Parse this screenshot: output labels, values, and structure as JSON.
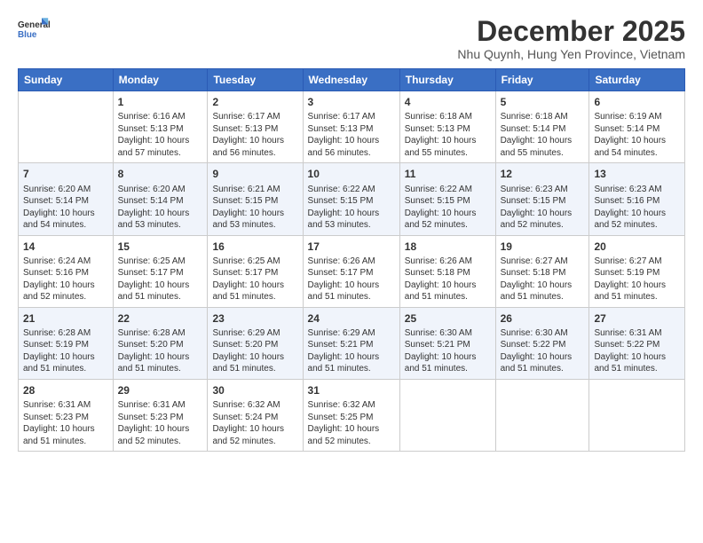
{
  "header": {
    "logo_line1": "General",
    "logo_line2": "Blue",
    "month": "December 2025",
    "location": "Nhu Quynh, Hung Yen Province, Vietnam"
  },
  "weekdays": [
    "Sunday",
    "Monday",
    "Tuesday",
    "Wednesday",
    "Thursday",
    "Friday",
    "Saturday"
  ],
  "weeks": [
    [
      {
        "day": "",
        "text": ""
      },
      {
        "day": "1",
        "text": "Sunrise: 6:16 AM\nSunset: 5:13 PM\nDaylight: 10 hours\nand 57 minutes."
      },
      {
        "day": "2",
        "text": "Sunrise: 6:17 AM\nSunset: 5:13 PM\nDaylight: 10 hours\nand 56 minutes."
      },
      {
        "day": "3",
        "text": "Sunrise: 6:17 AM\nSunset: 5:13 PM\nDaylight: 10 hours\nand 56 minutes."
      },
      {
        "day": "4",
        "text": "Sunrise: 6:18 AM\nSunset: 5:13 PM\nDaylight: 10 hours\nand 55 minutes."
      },
      {
        "day": "5",
        "text": "Sunrise: 6:18 AM\nSunset: 5:14 PM\nDaylight: 10 hours\nand 55 minutes."
      },
      {
        "day": "6",
        "text": "Sunrise: 6:19 AM\nSunset: 5:14 PM\nDaylight: 10 hours\nand 54 minutes."
      }
    ],
    [
      {
        "day": "7",
        "text": "Sunrise: 6:20 AM\nSunset: 5:14 PM\nDaylight: 10 hours\nand 54 minutes."
      },
      {
        "day": "8",
        "text": "Sunrise: 6:20 AM\nSunset: 5:14 PM\nDaylight: 10 hours\nand 53 minutes."
      },
      {
        "day": "9",
        "text": "Sunrise: 6:21 AM\nSunset: 5:15 PM\nDaylight: 10 hours\nand 53 minutes."
      },
      {
        "day": "10",
        "text": "Sunrise: 6:22 AM\nSunset: 5:15 PM\nDaylight: 10 hours\nand 53 minutes."
      },
      {
        "day": "11",
        "text": "Sunrise: 6:22 AM\nSunset: 5:15 PM\nDaylight: 10 hours\nand 52 minutes."
      },
      {
        "day": "12",
        "text": "Sunrise: 6:23 AM\nSunset: 5:15 PM\nDaylight: 10 hours\nand 52 minutes."
      },
      {
        "day": "13",
        "text": "Sunrise: 6:23 AM\nSunset: 5:16 PM\nDaylight: 10 hours\nand 52 minutes."
      }
    ],
    [
      {
        "day": "14",
        "text": "Sunrise: 6:24 AM\nSunset: 5:16 PM\nDaylight: 10 hours\nand 52 minutes."
      },
      {
        "day": "15",
        "text": "Sunrise: 6:25 AM\nSunset: 5:17 PM\nDaylight: 10 hours\nand 51 minutes."
      },
      {
        "day": "16",
        "text": "Sunrise: 6:25 AM\nSunset: 5:17 PM\nDaylight: 10 hours\nand 51 minutes."
      },
      {
        "day": "17",
        "text": "Sunrise: 6:26 AM\nSunset: 5:17 PM\nDaylight: 10 hours\nand 51 minutes."
      },
      {
        "day": "18",
        "text": "Sunrise: 6:26 AM\nSunset: 5:18 PM\nDaylight: 10 hours\nand 51 minutes."
      },
      {
        "day": "19",
        "text": "Sunrise: 6:27 AM\nSunset: 5:18 PM\nDaylight: 10 hours\nand 51 minutes."
      },
      {
        "day": "20",
        "text": "Sunrise: 6:27 AM\nSunset: 5:19 PM\nDaylight: 10 hours\nand 51 minutes."
      }
    ],
    [
      {
        "day": "21",
        "text": "Sunrise: 6:28 AM\nSunset: 5:19 PM\nDaylight: 10 hours\nand 51 minutes."
      },
      {
        "day": "22",
        "text": "Sunrise: 6:28 AM\nSunset: 5:20 PM\nDaylight: 10 hours\nand 51 minutes."
      },
      {
        "day": "23",
        "text": "Sunrise: 6:29 AM\nSunset: 5:20 PM\nDaylight: 10 hours\nand 51 minutes."
      },
      {
        "day": "24",
        "text": "Sunrise: 6:29 AM\nSunset: 5:21 PM\nDaylight: 10 hours\nand 51 minutes."
      },
      {
        "day": "25",
        "text": "Sunrise: 6:30 AM\nSunset: 5:21 PM\nDaylight: 10 hours\nand 51 minutes."
      },
      {
        "day": "26",
        "text": "Sunrise: 6:30 AM\nSunset: 5:22 PM\nDaylight: 10 hours\nand 51 minutes."
      },
      {
        "day": "27",
        "text": "Sunrise: 6:31 AM\nSunset: 5:22 PM\nDaylight: 10 hours\nand 51 minutes."
      }
    ],
    [
      {
        "day": "28",
        "text": "Sunrise: 6:31 AM\nSunset: 5:23 PM\nDaylight: 10 hours\nand 51 minutes."
      },
      {
        "day": "29",
        "text": "Sunrise: 6:31 AM\nSunset: 5:23 PM\nDaylight: 10 hours\nand 52 minutes."
      },
      {
        "day": "30",
        "text": "Sunrise: 6:32 AM\nSunset: 5:24 PM\nDaylight: 10 hours\nand 52 minutes."
      },
      {
        "day": "31",
        "text": "Sunrise: 6:32 AM\nSunset: 5:25 PM\nDaylight: 10 hours\nand 52 minutes."
      },
      {
        "day": "",
        "text": ""
      },
      {
        "day": "",
        "text": ""
      },
      {
        "day": "",
        "text": ""
      }
    ]
  ]
}
